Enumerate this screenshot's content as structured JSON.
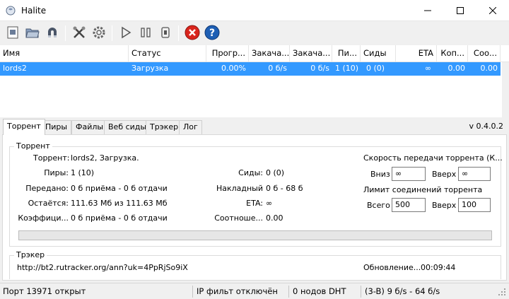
{
  "window": {
    "title": "Halite"
  },
  "list": {
    "columns": [
      "Имя",
      "Статус",
      "Прогр...",
      "Закача...",
      "Закача...",
      "Пи...",
      "Сиды",
      "ETA",
      "Коп...",
      "Соо..."
    ],
    "rows": [
      {
        "name": "lords2",
        "status": "Загрузка",
        "progress": "0.00%",
        "down": "0 б/s",
        "up": "0 б/s",
        "peers": "1 (10)",
        "seeds": "0 (0)",
        "eta": "∞",
        "copies": "0.00",
        "ratio": "0.00"
      }
    ]
  },
  "tabs": [
    "Торрент",
    "Пиры",
    "Файлы",
    "Веб сиды",
    "Трэкер",
    "Лог"
  ],
  "version": "v 0.4.0.2",
  "torrent_group": {
    "title": "Торрент",
    "torrent_label": "Торрент:",
    "torrent_value": "lords2, Загрузка.",
    "peers_label": "Пиры:",
    "peers_value": "1 (10)",
    "seeds_label": "Сиды:",
    "seeds_value": "0 (0)",
    "transferred_label": "Передано:",
    "transferred_value": "0 б приёма - 0 б отдачи",
    "overhead_label": "Накладный",
    "overhead_value": "0 б - 68 б",
    "remaining_label": "Остаётся:",
    "remaining_value": "111.63 Мб из 111.63 Мб",
    "eta_label": "ETA:",
    "eta_value": "∞",
    "coeff_label": "Коэффици...",
    "coeff_value": "0 б приёма - 0 б отдачи",
    "ratio_label": "Соотноше...",
    "ratio_value": "0.00",
    "progress_fraction": 0
  },
  "speed": {
    "title": "Скорость передачи торрента (К...",
    "down_label": "Вниз",
    "down_value": "∞",
    "up_label": "Вверх",
    "up_value": "∞",
    "conn_title": "Лимит соединений торрента",
    "total_label": "Всего",
    "total_value": "500",
    "conn_up_label": "Вверх",
    "conn_up_value": "100"
  },
  "tracker_group": {
    "title": "Трэкер",
    "url": "http://bt2.rutracker.org/ann?uk=4PpRjSo9iX",
    "update_label": "Обновление...",
    "update_value": "00:09:44"
  },
  "status": {
    "port": "Порт 13971 открыт",
    "ipfilter": "IP фильт отключён",
    "dht": "0 нодов DHT",
    "speed": "(3-B) 9 б/s - 64 б/s"
  },
  "icons": [
    "app-icon",
    "add-torrent-icon",
    "open-folder-icon",
    "magnet-icon",
    "settings-tools-icon",
    "gear-icon",
    "play-icon",
    "pause-icon",
    "stop-icon",
    "remove-icon",
    "help-icon"
  ],
  "colors": {
    "selection": "#3399ff",
    "remove": "#d9251d",
    "help": "#1e5fb4"
  }
}
